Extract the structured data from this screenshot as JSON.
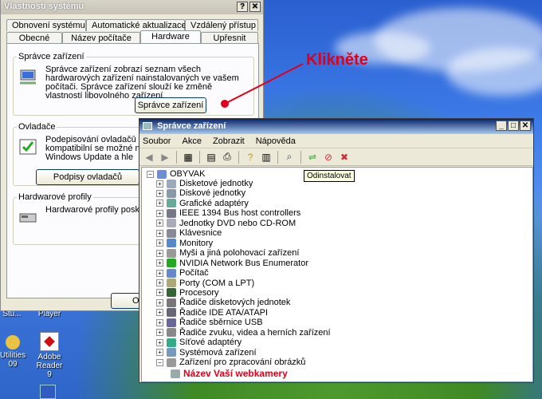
{
  "desktop": {
    "icons": [
      {
        "label": "Stu...",
        "x": 0
      },
      {
        "label": "Player",
        "x": 48
      },
      {
        "label": "Utilities",
        "x": 0
      },
      {
        "label": "Adobe Reader",
        "x": 34
      }
    ],
    "icon_sub": [
      "09",
      "9"
    ]
  },
  "props": {
    "title": "Vlastnosti systému",
    "tabs_row1": [
      "Obnovení systému",
      "Automatické aktualizace",
      "Vzdálený přístup"
    ],
    "tabs_row2": [
      "Obecné",
      "Název počítače",
      "Hardware",
      "Upřesnit"
    ],
    "groups": {
      "devmgr": {
        "title": "Správce zařízení",
        "text": "Správce zařízení zobrazí seznam všech hardwarových zařízení nainstalovaných ve vašem počítači. Správce zařízení slouží ke změně vlastností libovolného zařízení.",
        "button": "Správce zařízení"
      },
      "drivers": {
        "title": "Ovladače",
        "text": "Podepisování ovladačů vám ovladače jsou kompatibilní se možné nastavit způsob, jakým webu Windows Update a hle",
        "button": "Podpisy ovladačů"
      },
      "profiles": {
        "title": "Hardwarové profily",
        "text": "Hardwarové profily poskytují konfigurace hardwaru."
      }
    },
    "ok_button": "OK"
  },
  "devmgr": {
    "title": "Správce zařízení",
    "menu": [
      "Soubor",
      "Akce",
      "Zobrazit",
      "Nápověda"
    ],
    "root": "OBYVAK",
    "nodes": [
      "Disketové jednotky",
      "Diskové jednotky",
      "Grafické adaptéry",
      "IEEE 1394 Bus host controllers",
      "Jednotky DVD nebo CD-ROM",
      "Klávesnice",
      "Monitory",
      "Myši a jiná polohovací zařízení",
      "NVIDIA Network Bus Enumerator",
      "Počítač",
      "Porty (COM a LPT)",
      "Procesory",
      "Řadiče disketových jednotek",
      "Řadiče IDE ATA/ATAPI",
      "Řadiče sběrnice USB",
      "Řadiče zvuku, videa a herních zařízení",
      "Síťové adaptéry",
      "Systémová zařízení",
      "Zařízení pro zpracování obrázků"
    ],
    "tooltip": "Odinstalovat"
  },
  "annotations": {
    "click": "Klikněte",
    "webcam": "Název Vaší webkamery"
  },
  "colors": {
    "annotation_red": "#e0001b",
    "titlebar_blue": "#0a246a"
  }
}
